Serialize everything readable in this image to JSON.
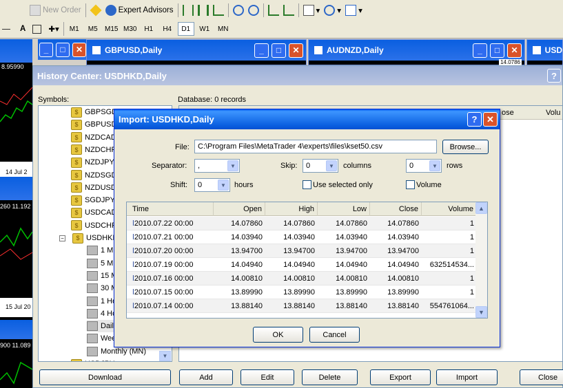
{
  "toolbar": {
    "new_order": "New Order",
    "expert_advisors": "Expert Advisors",
    "timeframes": [
      "M1",
      "M5",
      "M15",
      "M30",
      "H1",
      "H4",
      "D1",
      "W1",
      "MN"
    ],
    "active_timeframe": "D1",
    "text_tool": "A"
  },
  "charts": [
    {
      "title": "",
      "price_a": "8.95990",
      "date_a": "14 Jul 2",
      "price_b": "260 11.192",
      "date_b": "15 Jul 20",
      "price_c": "900 11.089"
    },
    {
      "title": "GBPUSD,Daily"
    },
    {
      "title": "AUDNZD,Daily",
      "price": "14.0786"
    },
    {
      "title": "USD"
    }
  ],
  "history_center": {
    "title": "History Center: USDHKD,Daily",
    "symbols_label": "Symbols:",
    "database_label": "Database: 0 records",
    "col_partial_close": "ose",
    "col_volume": "Volu",
    "symbols": [
      "GBPSGD",
      "GBPUSD",
      "NZDCAD",
      "NZDCHF",
      "NZDJPY",
      "NZDSGD",
      "NZDUSD",
      "SGDJPY",
      "USDCAD",
      "USDCHF",
      "USDHKD"
    ],
    "timeframes": [
      "1 Mi",
      "5 Mi",
      "15 M",
      "30 M",
      "1 Ho",
      "4 Ho",
      "Daily",
      "Wee",
      "Monthly (MN)"
    ],
    "next_symbol": "USDJPY",
    "buttons": {
      "download": "Download",
      "add": "Add",
      "edit": "Edit",
      "delete": "Delete",
      "export": "Export",
      "import": "Import",
      "close": "Close"
    }
  },
  "import_dialog": {
    "title": "Import: USDHKD,Daily",
    "file_label": "File:",
    "file_value": "C:\\Program Files\\MetaTrader 4\\experts\\files\\kset50.csv",
    "browse": "Browse...",
    "separator_label": "Separator:",
    "separator_value": ",",
    "skip_label": "Skip:",
    "skip_value": "0",
    "columns_label": "columns",
    "rows_value": "0",
    "rows_label": "rows",
    "shift_label": "Shift:",
    "shift_value": "0",
    "hours_label": "hours",
    "use_selected_only": "Use selected only",
    "volume_chk": "Volume",
    "headers": [
      "Time",
      "Open",
      "High",
      "Low",
      "Close",
      "Volume"
    ],
    "rows": [
      [
        "2010.07.22 00:00",
        "14.07860",
        "14.07860",
        "14.07860",
        "14.07860",
        "1"
      ],
      [
        "2010.07.21 00:00",
        "14.03940",
        "14.03940",
        "14.03940",
        "14.03940",
        "1"
      ],
      [
        "2010.07.20 00:00",
        "13.94700",
        "13.94700",
        "13.94700",
        "13.94700",
        "1"
      ],
      [
        "2010.07.19 00:00",
        "14.04940",
        "14.04940",
        "14.04940",
        "14.04940",
        "632514534..."
      ],
      [
        "2010.07.16 00:00",
        "14.00810",
        "14.00810",
        "14.00810",
        "14.00810",
        "1"
      ],
      [
        "2010.07.15 00:00",
        "13.89990",
        "13.89990",
        "13.89990",
        "13.89990",
        "1"
      ],
      [
        "2010.07.14 00:00",
        "13.88140",
        "13.88140",
        "13.88140",
        "13.88140",
        "554761064..."
      ]
    ],
    "ok": "OK",
    "cancel": "Cancel"
  }
}
